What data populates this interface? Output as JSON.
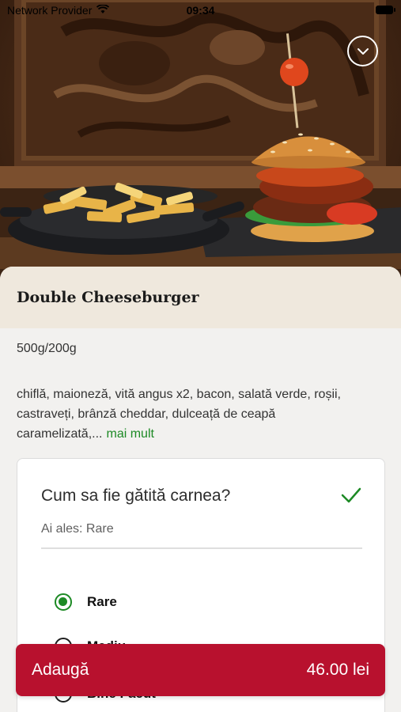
{
  "status_bar": {
    "carrier": "Network Provider",
    "time": "09:34"
  },
  "icons": {
    "wifi": "wifi-icon",
    "battery": "battery-icon",
    "collapse": "chevron-down-icon",
    "confirm": "check-icon"
  },
  "product": {
    "name": "Double Cheeseburger",
    "weight": "500g/200g",
    "description": "chiflă, maioneză, vită angus x2, bacon, salată verde, roșii, castraveți, brânză cheddar, dulceață de ceapă caramelizată,...",
    "more_label": "mai mult"
  },
  "options": {
    "question": "Cum sa fie gătită carnea?",
    "selected_text": "Ai ales: Rare",
    "items": [
      {
        "label": "Rare",
        "selected": true
      },
      {
        "label": "Mediu",
        "selected": false
      },
      {
        "label": "Bine Făcut",
        "selected": false
      }
    ]
  },
  "cart": {
    "add_label": "Adaugă",
    "price": "46.00 lei"
  },
  "colors": {
    "accent_green": "#1d8a25",
    "primary_red": "#b8112e",
    "title_bar": "#efe8dd",
    "background": "#f2f1ef"
  }
}
